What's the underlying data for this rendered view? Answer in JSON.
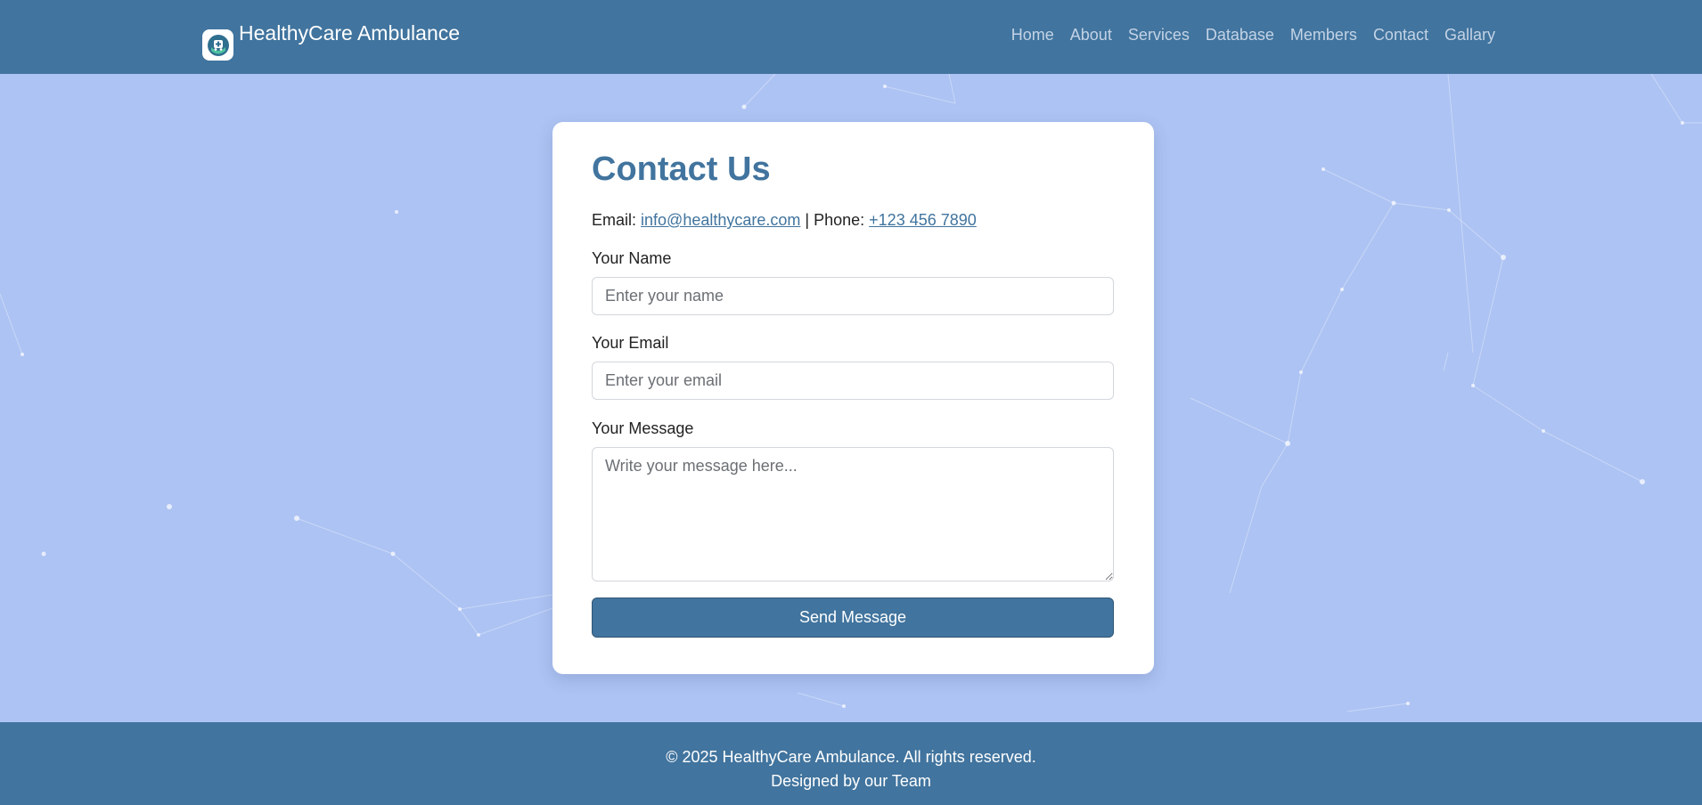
{
  "navbar": {
    "brand_name": "HealthyCare Ambulance",
    "logo_icon": "ambulance-logo-icon",
    "links": [
      "Home",
      "About",
      "Services",
      "Database",
      "Members",
      "Contact",
      "Gallary"
    ]
  },
  "contact": {
    "title": "Contact Us",
    "email_prefix": "Email:",
    "email": "info@healthycare.com",
    "separator": "| Phone:",
    "phone": "+123 456 7890",
    "name_label": "Your Name",
    "name_placeholder": "Enter your name",
    "email_label": "Your Email",
    "email_placeholder": "Enter your email",
    "message_label": "Your Message",
    "message_placeholder": "Write your message here...",
    "submit_label": "Send Message"
  },
  "footer": {
    "copyright": "© 2025 HealthyCare Ambulance. All rights reserved.",
    "credit": "Designed by our Team"
  },
  "colors": {
    "primary": "#41749e",
    "background": "#adc3f3",
    "card": "#ffffff"
  }
}
